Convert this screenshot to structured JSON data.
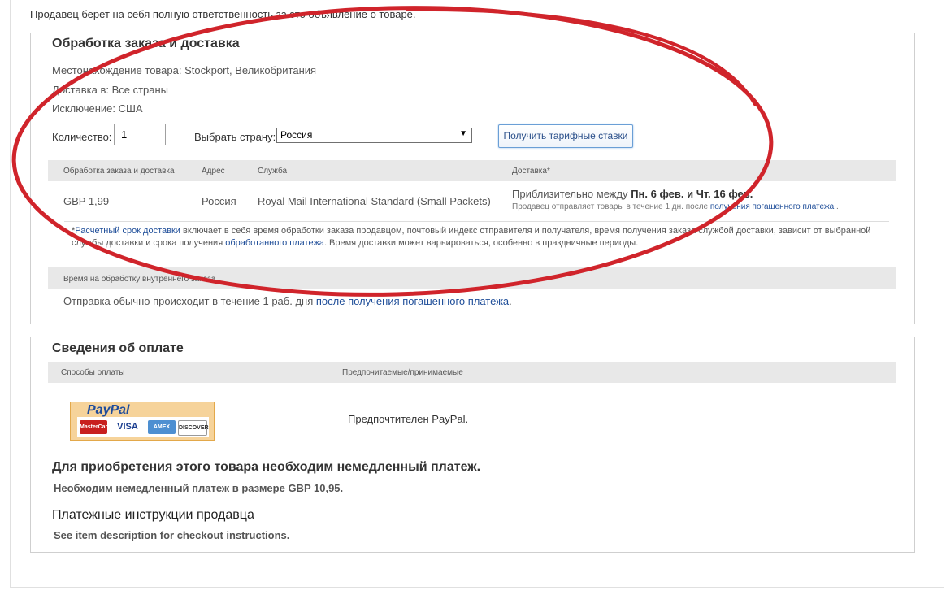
{
  "disclaimer": "Продавец берет на себя полную ответственность за это объявление о товаре.",
  "shipping": {
    "title": "Обработка заказа и доставка",
    "location": "Местонахождение товара: Stockport, Великобритания",
    "ships_to": "Доставка в: Все страны",
    "excludes": "Исключение: США",
    "quantity_label": "Количество:",
    "quantity_value": "1",
    "country_label": "Выбрать страну:",
    "country_value": "Россия",
    "rates_button": "Получить тарифные ставки",
    "table": {
      "headers": [
        "Обработка заказа и доставка",
        "Адрес",
        "Служба",
        "Доставка*"
      ],
      "row": {
        "cost": "GBP 1,99",
        "address": "Россия",
        "service": "Royal Mail International Standard (Small Packets)",
        "delivery_prefix": "Приблизительно между",
        "delivery_dates": "Пн. 6 фев. и Чт. 16 фев.",
        "delivery_sub_prefix": "Продавец отправляет товары в течение 1 дн. после",
        "delivery_sub_link": "получения погашенного платежа",
        "delivery_sub_suffix": "."
      }
    },
    "note": {
      "star": "*",
      "link1": "Расчетный срок доставки",
      "text1": " включает в себя время обработки заказа продавцом, почтовый индекс отправителя и получателя, время получения заказа службой доставки, зависит от выбранной службы доставки и срока получения ",
      "link2": "обработанного платежа",
      "text2": ". Время доставки может варьироваться, особенно в праздничные периоды."
    },
    "handling_header": "Время на обработку внутреннего заказа",
    "handling_text": "Отправка обычно происходит в течение 1 раб. дня ",
    "handling_link": "после получения погашенного платежа",
    "handling_suffix": "."
  },
  "payment": {
    "title": "Сведения об оплате",
    "headers": [
      "Способы оплаты",
      "Предпочитаемые/принимаемые"
    ],
    "paypal_logo": "PayPal",
    "cards": [
      "MasterCard",
      "VISA",
      "AMEX",
      "DISCOVER"
    ],
    "preferred": "Предпочтителен PayPal.",
    "immediate_title": "Для приобретения этого товара необходим немедленный платеж.",
    "immediate_text": "Необходим немедленный платеж в размере GBP 10,95.",
    "instructions_title": "Платежные инструкции продавца",
    "instructions_text": "See item description for checkout instructions."
  },
  "colors": {
    "annotation": "#d0242b",
    "link": "#1f4e99",
    "header_bg": "#e8e8e8"
  }
}
